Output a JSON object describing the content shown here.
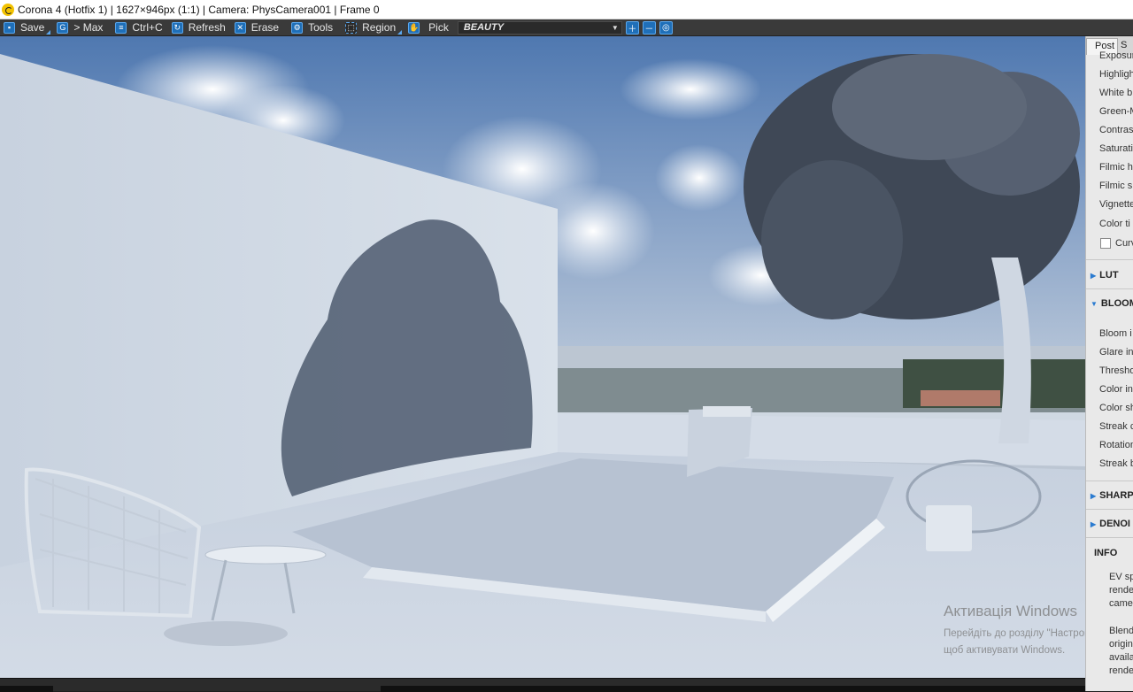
{
  "window": {
    "title": "Corona 4 (Hotfix 1) | 1627×946px (1:1) | Camera: PhysCamera001 | Frame 0"
  },
  "toolbar": {
    "save": "Save",
    "max": "> Max",
    "copy": "Ctrl+C",
    "refresh": "Refresh",
    "erase": "Erase",
    "tools": "Tools",
    "region": "Region",
    "pick": "Pick",
    "render_element": "BEAUTY"
  },
  "panel": {
    "tabs": [
      "Post",
      "S"
    ],
    "tonemapping_rows": [
      "Exposur",
      "Highligh",
      "White b",
      "Green-M",
      "Contras",
      "Saturati",
      "Filmic h",
      "Filmic s",
      "Vignette",
      "Color ti"
    ],
    "curves_label": "Curv",
    "sections": {
      "lut": "LUT",
      "bloom": "BLOOM",
      "sharpen": "SHARP",
      "denoise": "DENOI",
      "info": "INFO"
    },
    "bloom_rows": [
      "Bloom i",
      "Glare in",
      "Thresho",
      "Color in",
      "Color sh",
      "Streak c",
      "Rotation",
      "Streak b"
    ],
    "info_lines": [
      "EV spinn",
      "render us",
      "camera r",
      "Blending",
      "original v",
      "available",
      "rendering"
    ]
  },
  "watermark": {
    "title": "Активація Windows",
    "subtitle": "Перейдіть до розділу \"Настройки\", щоб активувати Windows."
  },
  "colors": {
    "accent": "#1f6fb8",
    "logo": "#f2c200",
    "toolbar_bg": "#3a3a3a"
  }
}
